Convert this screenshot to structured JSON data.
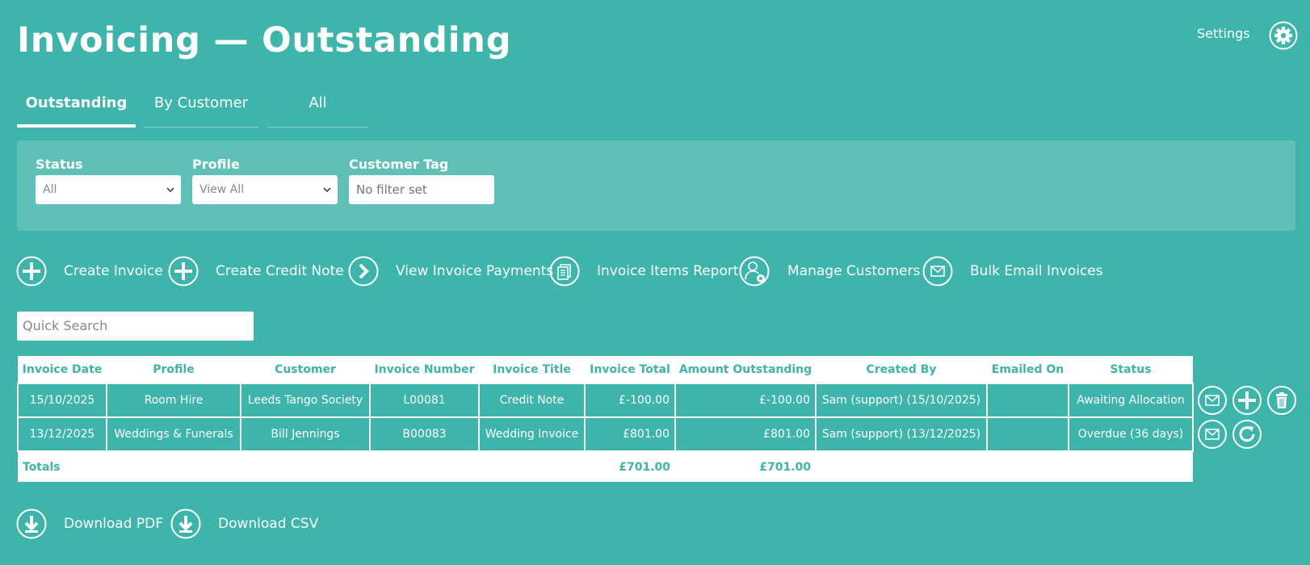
{
  "page": {
    "title": "Invoicing — Outstanding"
  },
  "header": {
    "settings_label": "Settings",
    "settings_icon": "gear-icon"
  },
  "tabs": [
    {
      "label": "Outstanding",
      "active": true
    },
    {
      "label": "By Customer",
      "active": false
    },
    {
      "label": "All",
      "active": false
    }
  ],
  "filters": {
    "status": {
      "label": "Status",
      "value": "All"
    },
    "profile": {
      "label": "Profile",
      "value": "View All"
    },
    "customer_tag": {
      "label": "Customer Tag",
      "placeholder": "No filter set"
    }
  },
  "actions": [
    {
      "label": "Create Invoice",
      "icon": "plus-circle-icon"
    },
    {
      "label": "Create Credit Note",
      "icon": "plus-circle-icon"
    },
    {
      "label": "View Invoice Payments",
      "icon": "chevron-right-circle-icon"
    },
    {
      "label": "Invoice Items Report",
      "icon": "documents-icon"
    },
    {
      "label": "Manage Customers",
      "icon": "user-settings-icon"
    },
    {
      "label": "Bulk Email Invoices",
      "icon": "envelope-icon"
    }
  ],
  "search": {
    "placeholder": "Quick Search"
  },
  "table": {
    "columns": [
      "Invoice Date",
      "Profile",
      "Customer",
      "Invoice Number",
      "Invoice Title",
      "Invoice Total",
      "Amount Outstanding",
      "Created By",
      "Emailed On",
      "Status"
    ],
    "rows": [
      {
        "invoice_date": "15/10/2025",
        "profile": "Room Hire",
        "customer": "Leeds Tango Society",
        "invoice_number": "L00081",
        "invoice_title": "Credit Note",
        "invoice_total": "£-100.00",
        "amount_outstanding": "£-100.00",
        "created_by": "Sam (support) (15/10/2025)",
        "emailed_on": "",
        "status": "Awaiting Allocation",
        "row_actions": [
          "envelope-icon",
          "plus-circle-icon",
          "trash-icon"
        ]
      },
      {
        "invoice_date": "13/12/2025",
        "profile": "Weddings & Funerals",
        "customer": "Bill Jennings",
        "invoice_number": "B00083",
        "invoice_title": "Wedding Invoice",
        "invoice_total": "£801.00",
        "amount_outstanding": "£801.00",
        "created_by": "Sam (support) (13/12/2025)",
        "emailed_on": "",
        "status": "Overdue (36 days)",
        "row_actions": [
          "envelope-icon",
          "refresh-icon"
        ]
      }
    ],
    "totals": {
      "label": "Totals",
      "invoice_total": "£701.00",
      "amount_outstanding": "£701.00"
    }
  },
  "downloads": [
    {
      "label": "Download PDF",
      "icon": "download-icon"
    },
    {
      "label": "Download CSV",
      "icon": "download-icon"
    }
  ],
  "colors": {
    "background": "#3db5aa",
    "panel": "#5ec0b6",
    "header_text": "#3db5aa"
  }
}
